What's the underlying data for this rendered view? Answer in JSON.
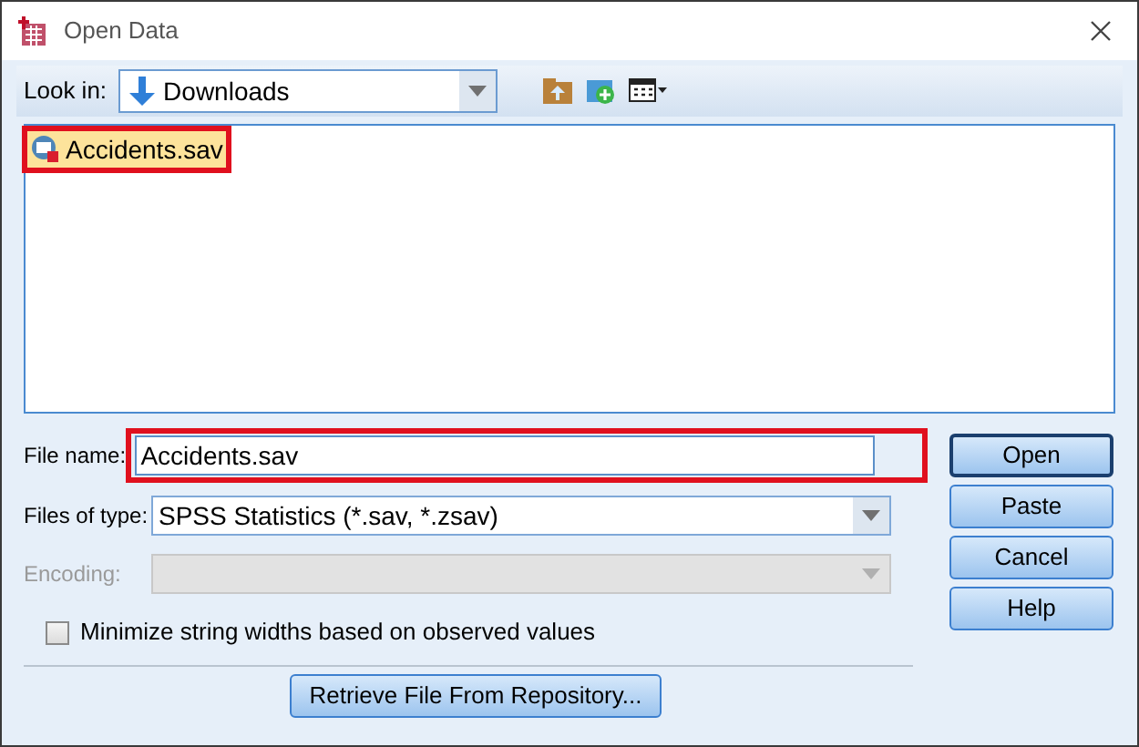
{
  "window": {
    "title": "Open Data"
  },
  "look_in": {
    "label": "Look in:",
    "value": "Downloads"
  },
  "files": [
    {
      "name": "Accidents.sav",
      "selected": true,
      "highlighted": true
    }
  ],
  "file_name": {
    "label": "File name:",
    "value": "Accidents.sav",
    "highlighted": true
  },
  "files_of_type": {
    "label": "Files of type:",
    "value": "SPSS Statistics (*.sav, *.zsav)",
    "disabled": false
  },
  "encoding": {
    "label": "Encoding:",
    "disabled": true
  },
  "minimize_checkbox": {
    "label": "Minimize string widths based on observed values",
    "checked": false
  },
  "buttons": [
    {
      "label": "Open",
      "default": true
    },
    {
      "label": "Paste",
      "default": false
    },
    {
      "label": "Cancel",
      "default": false
    },
    {
      "label": "Help",
      "default": false
    }
  ],
  "retrieve_button": {
    "label": "Retrieve File From Repository..."
  }
}
